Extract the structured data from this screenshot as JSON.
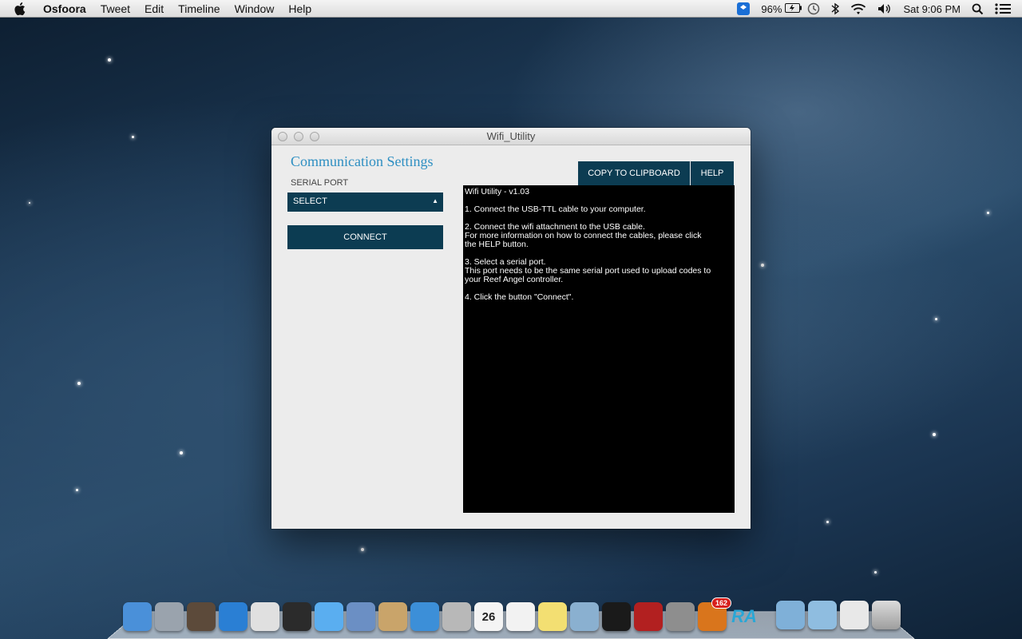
{
  "menubar": {
    "app_name": "Osfoora",
    "menus": [
      "Tweet",
      "Edit",
      "Timeline",
      "Window",
      "Help"
    ],
    "battery": "96%",
    "clock": "Sat 9:06 PM"
  },
  "window": {
    "title": "Wifi_Utility",
    "comm_title": "Communication Settings",
    "serial_port_label": "SERIAL PORT",
    "select_value": "SELECT",
    "connect_label": "CONNECT",
    "copy_label": "COPY TO CLIPBOARD",
    "help_label": "HELP",
    "console_lines": [
      "Wifi Utility - v1.03",
      "",
      "1. Connect the USB-TTL cable to your computer.",
      "",
      "2. Connect the wifi attachment to the USB cable.",
      "For more information on how to connect the cables, please click",
      "the HELP button.",
      "",
      "3. Select a serial port.",
      "This port needs to be the same serial port used to upload codes to",
      "your Reef Angel controller.",
      "",
      "4. Click the button \"Connect\"."
    ]
  },
  "dock": {
    "calendar_day": "26",
    "badge_count": "162",
    "ra_label": "RA",
    "apps": [
      {
        "name": "finder-icon",
        "color": "#4a90d9"
      },
      {
        "name": "launchpad-icon",
        "color": "#9aa3ad"
      },
      {
        "name": "photo-booth-icon",
        "color": "#5c4a3a"
      },
      {
        "name": "app-store-icon",
        "color": "#2a7fd4"
      },
      {
        "name": "chrome-icon",
        "color": "#e0e0e0"
      },
      {
        "name": "dashboard-icon",
        "color": "#2b2b2b"
      },
      {
        "name": "messages-icon",
        "color": "#5aaef0"
      },
      {
        "name": "mail-stamp-icon",
        "color": "#6b8fc4"
      },
      {
        "name": "contacts-icon",
        "color": "#c9a46a"
      },
      {
        "name": "itunes-icon",
        "color": "#3c8fd8"
      },
      {
        "name": "calculator-icon",
        "color": "#b8b8b8"
      },
      {
        "name": "calendar-icon",
        "color": "#f4f4f4"
      },
      {
        "name": "reminders-icon",
        "color": "#f2f2f2"
      },
      {
        "name": "notes-icon",
        "color": "#f3df72"
      },
      {
        "name": "preview-icon",
        "color": "#8ab0d0"
      },
      {
        "name": "terminal-icon",
        "color": "#1a1a1a"
      },
      {
        "name": "photo-booth-red-icon",
        "color": "#b22020"
      },
      {
        "name": "system-preferences-icon",
        "color": "#8e8e8e"
      },
      {
        "name": "osfoora-bird-icon",
        "color": "#d9751c"
      },
      {
        "name": "reef-angel-icon",
        "color": "transparent"
      }
    ]
  }
}
